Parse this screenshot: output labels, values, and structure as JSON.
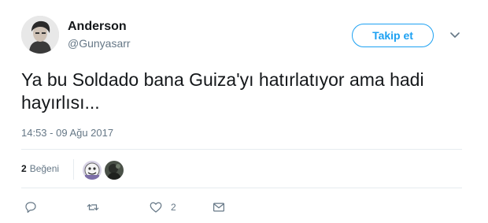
{
  "user": {
    "display_name": "Anderson",
    "handle": "@Gunyasarr",
    "avatar_icon": "user-avatar"
  },
  "header": {
    "follow_label": "Takip et",
    "caret_icon": "chevron-down-icon"
  },
  "tweet": {
    "text": "Ya bu Soldado bana Guiza'yı hatırlatıyor ama hadi hayırlısı...",
    "timestamp": "14:53 - 09 Ağu 2017"
  },
  "stats": {
    "likes_count": "2",
    "likes_label": "Beğeni",
    "liker_avatars": [
      "liker-avatar-1",
      "liker-avatar-2"
    ]
  },
  "actions": {
    "reply_icon": "reply-icon",
    "retweet_icon": "retweet-icon",
    "like_icon": "heart-icon",
    "like_count": "2",
    "message_icon": "envelope-icon"
  },
  "colors": {
    "accent": "#1da1f2",
    "secondary_text": "#657786",
    "primary_text": "#14171a",
    "divider": "#e6ecf0"
  }
}
